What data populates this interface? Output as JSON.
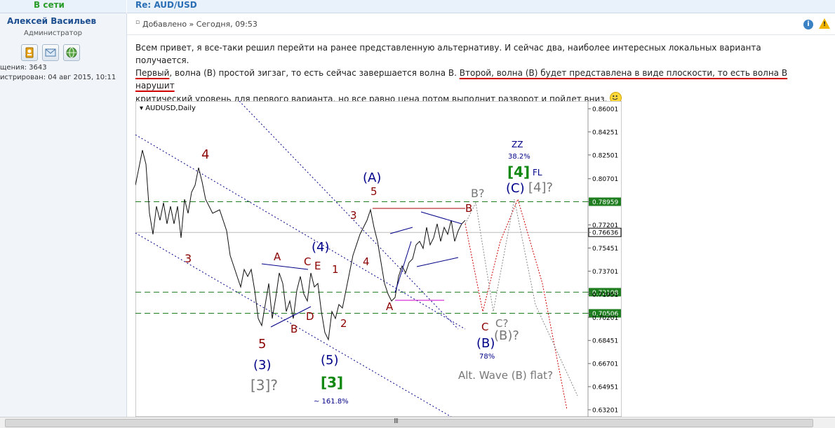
{
  "header": {
    "online_status": "В сети",
    "topic_title": "Re: AUD/USD"
  },
  "author": {
    "name": "Алексей Васильев",
    "role": "Администратор",
    "buttons": [
      "profile-icon",
      "message-icon",
      "web-icon"
    ],
    "posts_label": "щения: 3643",
    "registered_label": "истрирован: 04 авг 2015, 10:11"
  },
  "post": {
    "bullet": "▫",
    "meta": "Добавлено » Сегодня, 09:53",
    "text_1": "Всем привет, я все-таки решил перейти на ранее представленную альтернативу. И сейчас два, наиболее интересных локальных варианта получается.",
    "text_2a": "Первый",
    "text_2b": ", волна (B) простой зигзаг, то есть сейчас завершается волна B. ",
    "text_2c": "Второй, волна (B) будет представлена в виде плоскости, то есть волна В нарушит",
    "text_3a": "критический уровень для первого варианта",
    "text_3b": ", но все равно цена потом выполнит разворот и пойдет вниз.",
    "report_icon": "info-icon",
    "warn_icon": "warning-icon",
    "smiley_icon": "smiley-icon"
  },
  "chart": {
    "symbol": "▾ AUDUSD,Daily",
    "price_ticks": [
      "0.86001",
      "0.84251",
      "0.82501",
      "0.80701",
      "0.78959",
      "0.77201",
      "0.76636",
      "0.75451",
      "0.73701",
      "0.72108",
      "0.71951",
      "0.70506",
      "0.70201",
      "0.68451",
      "0.66701",
      "0.64951",
      "0.63201"
    ],
    "highlighted_levels": [
      "0.78959",
      "0.72108",
      "0.70506"
    ],
    "current_price": "0.76636",
    "labels": {
      "w4_red": "4",
      "w3_red": "3",
      "w5_red": "5",
      "w3_blue": "(3)",
      "w3_gray": "[3]?",
      "A_red1": "A",
      "B_red1": "B",
      "C_red1": "C",
      "D_red1": "D",
      "E_red1": "E",
      "w4_blue": "(4)",
      "w5_blue": "(5)",
      "w3_green": "[3]",
      "fib_1618": "~ 161.8%",
      "w1_red": "1",
      "w2_red": "2",
      "w3_red2": "3",
      "w4_red2": "4",
      "w5_red2": "5",
      "A_blue": "(A)",
      "A_red2": "A",
      "B_red2": "B",
      "B_gray": "B?",
      "C_red2": "C",
      "C_gray": "C?",
      "B_blue": "(B)",
      "fib_78": "78%",
      "B_gray2": "(B)?",
      "zz": "ZZ",
      "fib_382": "38.2%",
      "w4_green": "[4]",
      "fl": "FL",
      "C_blue": "(C)",
      "w4_gray": "[4]?",
      "alt_note": "Alt. Wave (B) flat?"
    }
  },
  "scrollbar": {
    "grip": "III"
  }
}
